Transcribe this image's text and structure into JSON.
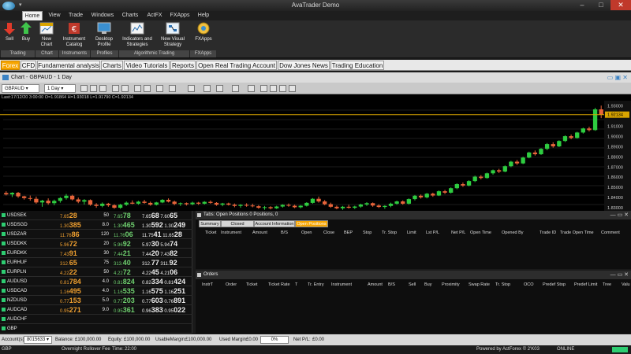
{
  "window": {
    "title": "AvaTrader Demo"
  },
  "menu": [
    "Home",
    "View",
    "Trade",
    "Windows",
    "Charts",
    "ActFX",
    "FXApps",
    "Help"
  ],
  "ribbon": {
    "buttons": [
      "Sell",
      "Buy",
      "New Chart",
      "Instrument Catalog",
      "Desktop Profile",
      "Indicators and Strategies",
      "New Visual Strategy",
      "FXApps"
    ],
    "groups": [
      "Trading",
      "Chart",
      "Instruments",
      "Profiles",
      "Algorithmic Trading",
      "FXApps"
    ]
  },
  "tabs": [
    "Forex",
    "CFD",
    "Fundamental analysis",
    "Charts",
    "Video Tutorials",
    "Reports",
    "Open Real Trading Account",
    "Dow Jones News",
    "Trading Education"
  ],
  "chart": {
    "window_title": "Chart - GBPAUD - 1 Day",
    "symbol": "GBPAUD",
    "timeframe": "1 Day",
    "ohlc_line": "Last:17/12/20   3:00:00 O=1.91864 H=1.93018 L=1.91790 C=1.92134",
    "price_labels": [
      "1.93000",
      "1.92134",
      "1.91000",
      "1.90000",
      "1.89000",
      "1.88000",
      "1.87000",
      "1.86000",
      "1.85000",
      "1.84000",
      "1.83000"
    ],
    "colors": {
      "up": "#2ecc40",
      "down": "#e8643a",
      "current_line": "#d9a400"
    }
  },
  "chart_data": {
    "type": "candlestick",
    "current_price": 1.92134,
    "ylim": [
      1.827,
      1.935
    ],
    "candles": [
      [
        1.8445,
        1.8462,
        1.8421,
        1.8431
      ],
      [
        1.8431,
        1.8452,
        1.8405,
        1.8447
      ],
      [
        1.8447,
        1.8455,
        1.8398,
        1.8412
      ],
      [
        1.8412,
        1.8418,
        1.838,
        1.8395
      ],
      [
        1.8395,
        1.842,
        1.837,
        1.8388
      ],
      [
        1.8388,
        1.841,
        1.834,
        1.8352
      ],
      [
        1.8352,
        1.8378,
        1.831,
        1.837
      ],
      [
        1.837,
        1.8392,
        1.833,
        1.8345
      ],
      [
        1.8345,
        1.838,
        1.8325,
        1.8368
      ],
      [
        1.8368,
        1.8405,
        1.835,
        1.8395
      ],
      [
        1.8395,
        1.8435,
        1.838,
        1.8418
      ],
      [
        1.8418,
        1.8428,
        1.8372,
        1.8382
      ],
      [
        1.8382,
        1.84,
        1.8345,
        1.836
      ],
      [
        1.836,
        1.8385,
        1.8332,
        1.8375
      ],
      [
        1.8375,
        1.8382,
        1.832,
        1.833
      ],
      [
        1.833,
        1.8345,
        1.83,
        1.8318
      ],
      [
        1.8318,
        1.8352,
        1.8305,
        1.834
      ],
      [
        1.834,
        1.8348,
        1.831,
        1.8325
      ],
      [
        1.8325,
        1.8335,
        1.829,
        1.83
      ],
      [
        1.83,
        1.8338,
        1.829,
        1.833
      ],
      [
        1.833,
        1.8362,
        1.8318,
        1.835
      ],
      [
        1.835,
        1.8372,
        1.8335,
        1.834
      ],
      [
        1.834,
        1.8368,
        1.833,
        1.836
      ],
      [
        1.836,
        1.8378,
        1.834,
        1.8348
      ],
      [
        1.8348,
        1.836,
        1.832,
        1.833
      ],
      [
        1.833,
        1.8358,
        1.8322,
        1.8352
      ],
      [
        1.8352,
        1.8385,
        1.8345,
        1.8378
      ],
      [
        1.8378,
        1.8392,
        1.8352,
        1.836
      ],
      [
        1.836,
        1.837,
        1.8325,
        1.8338
      ],
      [
        1.8338,
        1.8352,
        1.8318,
        1.8345
      ],
      [
        1.8345,
        1.8352,
        1.8322,
        1.8335
      ],
      [
        1.8335,
        1.836,
        1.8325,
        1.835
      ],
      [
        1.835,
        1.8358,
        1.8328,
        1.834
      ],
      [
        1.834,
        1.8365,
        1.8332,
        1.8358
      ],
      [
        1.8358,
        1.8372,
        1.834,
        1.8348
      ],
      [
        1.8348,
        1.8355,
        1.832,
        1.833
      ],
      [
        1.833,
        1.8348,
        1.8315,
        1.8342
      ],
      [
        1.8342,
        1.835,
        1.8322,
        1.833
      ],
      [
        1.833,
        1.8342,
        1.8305,
        1.8318
      ],
      [
        1.8318,
        1.8336,
        1.83,
        1.8328
      ],
      [
        1.8328,
        1.8344,
        1.831,
        1.8322
      ],
      [
        1.8322,
        1.834,
        1.8305,
        1.8315
      ],
      [
        1.8315,
        1.8326,
        1.829,
        1.83
      ],
      [
        1.83,
        1.8318,
        1.828,
        1.8306
      ],
      [
        1.8306,
        1.8315,
        1.8284,
        1.8295
      ],
      [
        1.8295,
        1.832,
        1.8288,
        1.8312
      ],
      [
        1.8312,
        1.8335,
        1.8302,
        1.8328
      ],
      [
        1.8328,
        1.8342,
        1.831,
        1.832
      ],
      [
        1.832,
        1.833,
        1.8296,
        1.8305
      ],
      [
        1.8305,
        1.8326,
        1.8294,
        1.832
      ],
      [
        1.832,
        1.8355,
        1.8312,
        1.8348
      ],
      [
        1.8348,
        1.8395,
        1.834,
        1.8388
      ],
      [
        1.8388,
        1.841,
        1.835,
        1.8362
      ],
      [
        1.8362,
        1.8376,
        1.8325,
        1.8335
      ],
      [
        1.8335,
        1.835,
        1.83,
        1.831
      ],
      [
        1.831,
        1.8322,
        1.8285,
        1.8295
      ],
      [
        1.8295,
        1.8318,
        1.828,
        1.831
      ],
      [
        1.831,
        1.833,
        1.8292,
        1.83
      ],
      [
        1.83,
        1.832,
        1.8288,
        1.8312
      ],
      [
        1.8312,
        1.834,
        1.83,
        1.8332
      ],
      [
        1.8332,
        1.8355,
        1.8318,
        1.8345
      ],
      [
        1.8345,
        1.8352,
        1.831,
        1.8322
      ],
      [
        1.8322,
        1.8335,
        1.8298,
        1.8308
      ],
      [
        1.8308,
        1.8325,
        1.829,
        1.8318
      ],
      [
        1.8318,
        1.835,
        1.8305,
        1.834
      ],
      [
        1.834,
        1.837,
        1.833,
        1.8362
      ],
      [
        1.8362,
        1.8372,
        1.833,
        1.834
      ],
      [
        1.834,
        1.8392,
        1.8332,
        1.8385
      ],
      [
        1.8385,
        1.8425,
        1.8372,
        1.8418
      ],
      [
        1.8418,
        1.843,
        1.839,
        1.8402
      ],
      [
        1.8402,
        1.8445,
        1.8392,
        1.8438
      ],
      [
        1.8438,
        1.8448,
        1.8408,
        1.842
      ],
      [
        1.842,
        1.847,
        1.8415,
        1.8462
      ],
      [
        1.8462,
        1.8475,
        1.8435,
        1.8448
      ],
      [
        1.8448,
        1.85,
        1.844,
        1.8492
      ],
      [
        1.8492,
        1.854,
        1.8482,
        1.8532
      ],
      [
        1.8532,
        1.8548,
        1.8505,
        1.8518
      ],
      [
        1.8518,
        1.857,
        1.851,
        1.8562
      ],
      [
        1.8562,
        1.8615,
        1.8552,
        1.8605
      ],
      [
        1.8605,
        1.862,
        1.8578,
        1.8592
      ],
      [
        1.8592,
        1.8645,
        1.8585,
        1.8638
      ],
      [
        1.8638,
        1.8675,
        1.8625,
        1.8668
      ],
      [
        1.8668,
        1.8682,
        1.864,
        1.8655
      ],
      [
        1.8655,
        1.8715,
        1.8648,
        1.8708
      ],
      [
        1.8708,
        1.876,
        1.8698,
        1.8752
      ],
      [
        1.8752,
        1.8768,
        1.872,
        1.8735
      ],
      [
        1.8735,
        1.88,
        1.8728,
        1.8792
      ],
      [
        1.8792,
        1.885,
        1.8785,
        1.8842
      ],
      [
        1.8842,
        1.8862,
        1.8812,
        1.8825
      ],
      [
        1.8825,
        1.8885,
        1.8818,
        1.8878
      ],
      [
        1.8878,
        1.8935,
        1.8865,
        1.8925
      ],
      [
        1.8925,
        1.8942,
        1.889,
        1.8902
      ],
      [
        1.8902,
        1.8962,
        1.8895,
        1.8955
      ],
      [
        1.8955,
        1.901,
        1.8945,
        1.9002
      ],
      [
        1.9002,
        1.9018,
        1.8972,
        1.8985
      ],
      [
        1.8985,
        1.9045,
        1.8978,
        1.9038
      ],
      [
        1.9038,
        1.9085,
        1.9028,
        1.9078
      ],
      [
        1.9078,
        1.9095,
        1.9048,
        1.9062
      ],
      [
        1.9062,
        1.928,
        1.9055,
        1.9265
      ],
      [
        1.9265,
        1.9302,
        1.9179,
        1.9213
      ]
    ]
  },
  "watchlist": [
    {
      "symbol": "USDSEK",
      "bid_small": "7.65",
      "bid_big": "28",
      "spread": "50",
      "ask_small": "7.65",
      "ask_big": "78",
      "hi_small": "7.65",
      "hi_big": "68",
      "lo_small": "7.60",
      "lo_big": "65"
    },
    {
      "symbol": "USDSGD",
      "bid_small": "1.30",
      "bid_big": "385",
      "spread": "8.0",
      "ask_small": "1.30",
      "ask_big": "465",
      "hi_small": "1.30",
      "hi_big": "592",
      "lo_small": "1.30",
      "lo_big": "249"
    },
    {
      "symbol": "USDZAR",
      "bid_small": "11.76",
      "bid_big": "86",
      "spread": "120",
      "ask_small": "11.76",
      "ask_big": "06",
      "hi_small": "11.75",
      "hi_big": "41",
      "lo_small": "11.65",
      "lo_big": "28"
    },
    {
      "symbol": "USDDKK",
      "bid_small": "5.96",
      "bid_big": "72",
      "spread": "20",
      "ask_small": "5.96",
      "ask_big": "92",
      "hi_small": "5.97",
      "hi_big": "30",
      "lo_small": "5.94",
      "lo_big": "74"
    },
    {
      "symbol": "EURDKK",
      "bid_small": "7.43",
      "bid_big": "91",
      "spread": "30",
      "ask_small": "7.44",
      "ask_big": "21",
      "hi_small": "7.44",
      "hi_big": "20",
      "lo_small": "7.43",
      "lo_big": "82"
    },
    {
      "symbol": "EURHUF",
      "bid_small": "312.",
      "bid_big": "65",
      "spread": "75",
      "ask_small": "313.",
      "ask_big": "40",
      "hi_small": "312.",
      "hi_big": "77",
      "lo_small": "311.",
      "lo_big": "92"
    },
    {
      "symbol": "EURPLN",
      "bid_small": "4.22",
      "bid_big": "22",
      "spread": "50",
      "ask_small": "4.22",
      "ask_big": "72",
      "hi_small": "4.22",
      "hi_big": "45",
      "lo_small": "4.21",
      "lo_big": "06"
    },
    {
      "symbol": "AUDUSD",
      "bid_small": "0.81",
      "bid_big": "784",
      "spread": "4.0",
      "ask_small": "0.81",
      "ask_big": "824",
      "hi_small": "0.82",
      "hi_big": "334",
      "lo_small": "0.81",
      "lo_big": "424"
    },
    {
      "symbol": "USDCAD",
      "bid_small": "1.16",
      "bid_big": "495",
      "spread": "4.0",
      "ask_small": "1.16",
      "ask_big": "535",
      "hi_small": "1.16",
      "hi_big": "575",
      "lo_small": "1.16",
      "lo_big": "251"
    },
    {
      "symbol": "NZDUSD",
      "bid_small": "0.77",
      "bid_big": "153",
      "spread": "5.0",
      "ask_small": "0.77",
      "ask_big": "203",
      "hi_small": "0.77",
      "hi_big": "603",
      "lo_small": "0.76",
      "lo_big": "891"
    },
    {
      "symbol": "AUDCAD",
      "bid_small": "0.95",
      "bid_big": "271",
      "spread": "9.0",
      "ask_small": "0.95",
      "ask_big": "361",
      "hi_small": "0.96",
      "hi_big": "383",
      "lo_small": "0.95",
      "lo_big": "022"
    },
    {
      "symbol": "AUDCHF",
      "bid_small": "",
      "bid_big": "",
      "spread": "",
      "ask_small": "",
      "ask_big": "",
      "hi_small": "",
      "hi_big": "",
      "lo_small": "",
      "lo_big": ""
    },
    {
      "symbol": "GBP",
      "bid_small": "",
      "bid_big": "",
      "spread": "",
      "ask_small": "",
      "ask_big": "",
      "hi_small": "",
      "hi_big": "",
      "lo_small": "",
      "lo_big": ""
    }
  ],
  "positions_panel": {
    "title": "Tabs: Open Positions 0 Positions, 0",
    "subtabs": [
      "Summary",
      "Closed Positions",
      "Account Information",
      "Open Positions"
    ],
    "columns": [
      "Ticket",
      "Instrument",
      "Amount",
      "B/S",
      "Open",
      "Close",
      "BEP",
      "Stop",
      "Tr. Stop",
      "Limit",
      "Lst P/L",
      "Net P/L",
      "Open Time",
      "Opened By",
      "Trade ID",
      "Trade Open Time",
      "Comment"
    ]
  },
  "orders_panel": {
    "title": "Orders",
    "columns": [
      "InstrT",
      "Order",
      "Ticket",
      "Ticket Rate",
      "T",
      "Tr. Entry",
      "Instrument",
      "Amount",
      "B/S",
      "Sell",
      "Buy",
      "Proximity",
      "Swap Rate",
      "Tr. Stop",
      "OCO",
      "Predef Stop",
      "Predef Limit",
      "Tree",
      "Valu"
    ]
  },
  "statusbar": {
    "account_label": "Account(s):",
    "account": "8015633",
    "balance_label": "Balance:",
    "balance": "£100,000.00",
    "equity_label": "Equity:",
    "equity": "£100,000.00",
    "usable_label": "UsableMargin:",
    "usable": "£100,000.00",
    "used_label": "Used Margin:",
    "used": "£0.00",
    "margin_pct": "0%",
    "net_label": "Net P/L:",
    "net": "£0.00"
  },
  "bottombar": {
    "left": "GBP",
    "rollover": "Overnight Rollover Fee",
    "time_label": "Time:",
    "time": "22:00",
    "powered": "Powered by ActForex © 2'K03",
    "status": "ONLINE"
  }
}
